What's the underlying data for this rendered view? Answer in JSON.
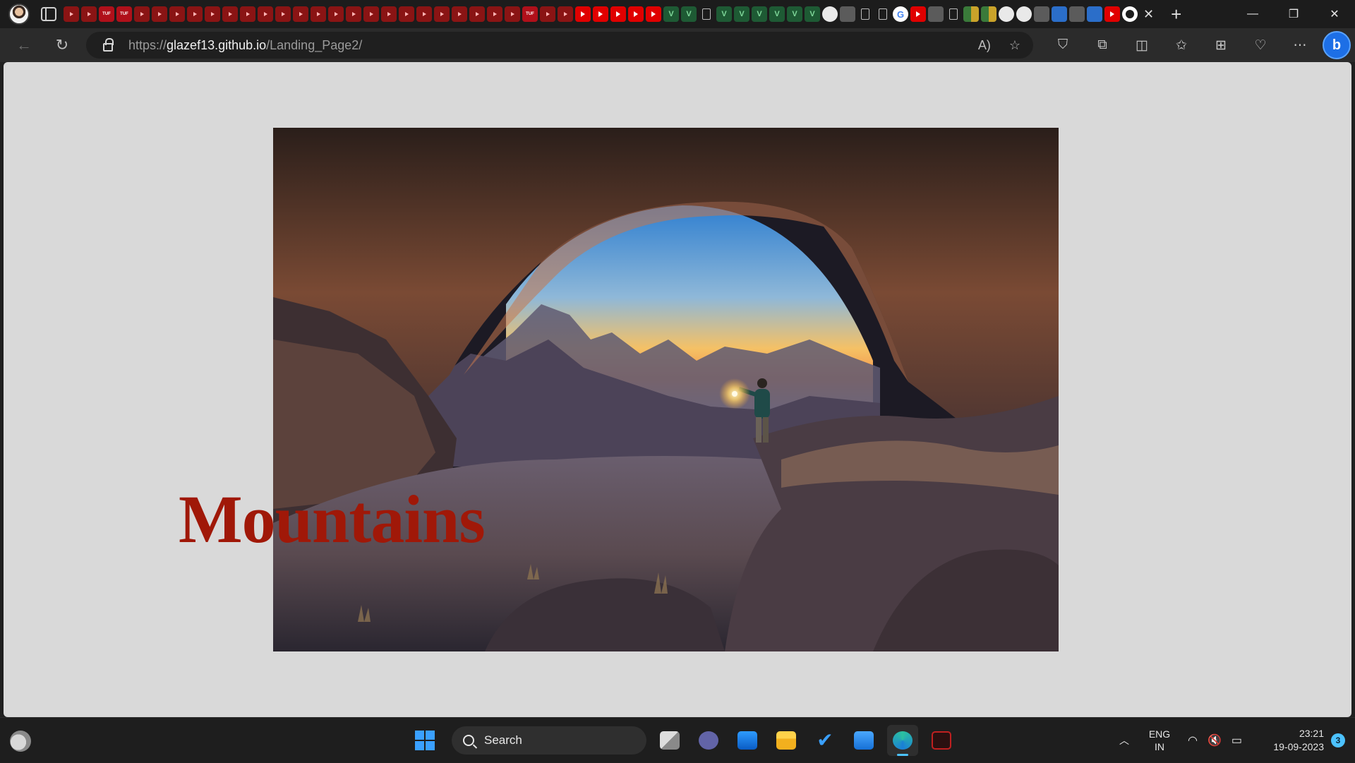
{
  "browser": {
    "address": {
      "scheme": "https://",
      "host": "glazef13.github.io",
      "path": "/Landing_Page2/"
    },
    "pinned_tabs": [
      "yt",
      "yt",
      "tuf",
      "tuf",
      "yt",
      "yt",
      "yt",
      "yt",
      "yt",
      "yt",
      "yt",
      "yt",
      "yt",
      "yt",
      "yt",
      "yt",
      "yt",
      "yt",
      "yt",
      "yt",
      "yt",
      "yt",
      "yt",
      "yt",
      "yt",
      "yt",
      "tuf",
      "yt",
      "yt",
      "ytr",
      "ytr",
      "ytr",
      "ytr",
      "ytr",
      "green",
      "green",
      "doc",
      "green",
      "green",
      "green",
      "green",
      "green",
      "green",
      "circ",
      "gray",
      "doc",
      "doc",
      "g",
      "ytr",
      "gray",
      "doc",
      "tile",
      "tile",
      "circ",
      "circ",
      "gray",
      "blue",
      "gray",
      "blue",
      "ytr",
      "gh"
    ],
    "icons": {
      "back": "back-arrow-icon",
      "reload": "reload-icon",
      "read_aloud": "read-aloud-icon",
      "favorite": "star-icon",
      "pocket": "pocket-icon",
      "extensions": "puzzle-icon",
      "split": "split-screen-icon",
      "favorites": "favorites-icon",
      "collections": "collections-icon",
      "performance": "heart-pulse-icon",
      "more": "more-icon",
      "copilot": "bing-copilot-icon"
    }
  },
  "page": {
    "heading": "Mountains",
    "heading_color": "#a01808",
    "background": "#d9d9d9",
    "image_alt_subject": "rock arch at sunrise with hiker holding lantern"
  },
  "taskbar": {
    "search_label": "Search",
    "language": "ENG",
    "region": "IN",
    "time": "23:21",
    "date": "19-09-2023",
    "notification_count": "3",
    "accent": "#4cc2ff"
  }
}
